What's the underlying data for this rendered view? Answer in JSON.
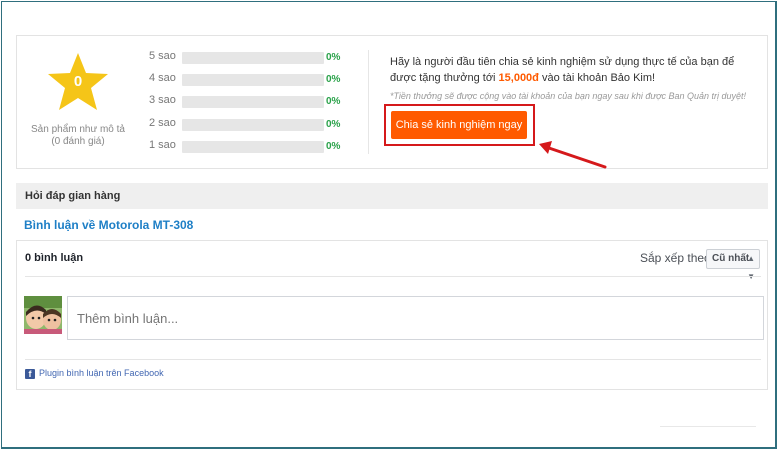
{
  "rating": {
    "score": "0",
    "caption_line1": "Sản phẩm như mô tả",
    "caption_line2": "(0 đánh giá)",
    "star_color": "#f5c518",
    "bars": [
      {
        "label": "5 sao",
        "percent": "0%",
        "fill": 0
      },
      {
        "label": "4 sao",
        "percent": "0%",
        "fill": 0
      },
      {
        "label": "3 sao",
        "percent": "0%",
        "fill": 0
      },
      {
        "label": "2 sao",
        "percent": "0%",
        "fill": 0
      },
      {
        "label": "1 sao",
        "percent": "0%",
        "fill": 0
      }
    ]
  },
  "promo": {
    "text_before": "Hãy là người đầu tiên chia sẻ kinh nghiệm sử dụng thực tế của bạn để được tặng thưởng tới ",
    "amount": "15,000đ",
    "text_after": " vào tài khoản Bảo Kim!",
    "note": "*Tiền thưởng sẽ được cộng vào tài khoản của bạn ngay sau khi được Ban Quản trị duyệt!",
    "button_label": "Chia sẻ kinh nghiệm ngay",
    "button_color": "#ff5a00",
    "highlight_color": "#d5191b"
  },
  "qa": {
    "header": "Hỏi đáp gian hàng",
    "section_title": "Bình luận về Motorola MT-308"
  },
  "comments": {
    "count_label": "0 bình luận",
    "sort_label": "Sắp xếp theo",
    "sort_value": "Cũ nhất",
    "input_placeholder": "Thêm bình luận...",
    "plugin_label": "Plugin bình luận trên Facebook",
    "avatar_icon": "user-avatar",
    "facebook_icon": "facebook-icon"
  }
}
